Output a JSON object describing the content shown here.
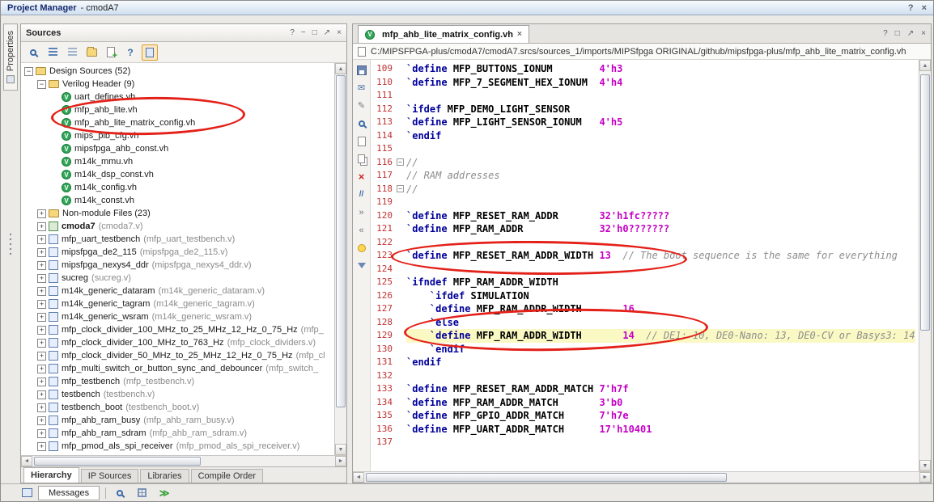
{
  "titlebar": {
    "app": "Project Manager",
    "project": "- cmodA7"
  },
  "glyphs": {
    "help": "?",
    "min": "−",
    "max": "□",
    "float": "↗",
    "close": "×",
    "up": "▲",
    "down": "▼",
    "left": "◄",
    "right": "►",
    "envelope": "✉",
    "pencil": "✎",
    "delete": "×",
    "comment": "//",
    "indent": "»",
    "outdent": "«",
    "run": "≫"
  },
  "side": {
    "properties_tab": "Properties"
  },
  "sources": {
    "title": "Sources",
    "active_tab": "Hierarchy",
    "tabs": [
      "Hierarchy",
      "IP Sources",
      "Libraries",
      "Compile Order"
    ],
    "tree": [
      {
        "label": "Design Sources (52)",
        "indent": 0,
        "exp": "-",
        "icon": "folder"
      },
      {
        "label": "Verilog Header (9)",
        "indent": 1,
        "exp": "-",
        "icon": "folder"
      },
      {
        "label": "uart_defines.vh",
        "indent": 2,
        "icon": "vh"
      },
      {
        "label": "mfp_ahb_lite.vh",
        "indent": 2,
        "icon": "vh"
      },
      {
        "label": "mfp_ahb_lite_matrix_config.vh",
        "indent": 2,
        "icon": "vh"
      },
      {
        "label": "mips_pib_cfg.vh",
        "indent": 2,
        "icon": "vh"
      },
      {
        "label": "mipsfpga_ahb_const.vh",
        "indent": 2,
        "icon": "vh"
      },
      {
        "label": "m14k_mmu.vh",
        "indent": 2,
        "icon": "vh"
      },
      {
        "label": "m14k_dsp_const.vh",
        "indent": 2,
        "icon": "vh"
      },
      {
        "label": "m14k_config.vh",
        "indent": 2,
        "icon": "vh"
      },
      {
        "label": "m14k_const.vh",
        "indent": 2,
        "icon": "vh"
      },
      {
        "label": "Non-module Files (23)",
        "indent": 1,
        "exp": "+",
        "icon": "folder"
      },
      {
        "label": "cmoda7",
        "sub": "(cmoda7.v)",
        "indent": 1,
        "exp": "+",
        "icon": "top",
        "bold": true
      },
      {
        "label": "mfp_uart_testbench",
        "sub": "(mfp_uart_testbench.v)",
        "indent": 1,
        "exp": "+",
        "icon": "mod"
      },
      {
        "label": "mipsfpga_de2_115",
        "sub": "(mipsfpga_de2_115.v)",
        "indent": 1,
        "exp": "+",
        "icon": "mod"
      },
      {
        "label": "mipsfpga_nexys4_ddr",
        "sub": "(mipsfpga_nexys4_ddr.v)",
        "indent": 1,
        "exp": "+",
        "icon": "mod"
      },
      {
        "label": "sucreg",
        "sub": "(sucreg.v)",
        "indent": 1,
        "exp": "+",
        "icon": "mod"
      },
      {
        "label": "m14k_generic_dataram",
        "sub": "(m14k_generic_dataram.v)",
        "indent": 1,
        "exp": "+",
        "icon": "mod"
      },
      {
        "label": "m14k_generic_tagram",
        "sub": "(m14k_generic_tagram.v)",
        "indent": 1,
        "exp": "+",
        "icon": "mod"
      },
      {
        "label": "m14k_generic_wsram",
        "sub": "(m14k_generic_wsram.v)",
        "indent": 1,
        "exp": "+",
        "icon": "mod"
      },
      {
        "label": "mfp_clock_divider_100_MHz_to_25_MHz_12_Hz_0_75_Hz",
        "sub": "(mfp_",
        "indent": 1,
        "exp": "+",
        "icon": "mod"
      },
      {
        "label": "mfp_clock_divider_100_MHz_to_763_Hz",
        "sub": "(mfp_clock_dividers.v)",
        "indent": 1,
        "exp": "+",
        "icon": "mod"
      },
      {
        "label": "mfp_clock_divider_50_MHz_to_25_MHz_12_Hz_0_75_Hz",
        "sub": "(mfp_cl",
        "indent": 1,
        "exp": "+",
        "icon": "mod"
      },
      {
        "label": "mfp_multi_switch_or_button_sync_and_debouncer",
        "sub": "(mfp_switch_",
        "indent": 1,
        "exp": "+",
        "icon": "mod"
      },
      {
        "label": "mfp_testbench",
        "sub": "(mfp_testbench.v)",
        "indent": 1,
        "exp": "+",
        "icon": "mod"
      },
      {
        "label": "testbench",
        "sub": "(testbench.v)",
        "indent": 1,
        "exp": "+",
        "icon": "mod"
      },
      {
        "label": "testbench_boot",
        "sub": "(testbench_boot.v)",
        "indent": 1,
        "exp": "+",
        "icon": "mod"
      },
      {
        "label": "mfp_ahb_ram_busy",
        "sub": "(mfp_ahb_ram_busy.v)",
        "indent": 1,
        "exp": "+",
        "icon": "mod"
      },
      {
        "label": "mfp_ahb_ram_sdram",
        "sub": "(mfp_ahb_ram_sdram.v)",
        "indent": 1,
        "exp": "+",
        "icon": "mod"
      },
      {
        "label": "mfp_pmod_als_spi_receiver",
        "sub": "(mfp_pmod_als_spi_receiver.v)",
        "indent": 1,
        "exp": "+",
        "icon": "mod"
      }
    ]
  },
  "editor": {
    "tab_label": "mfp_ahb_lite_matrix_config.vh",
    "path": "C:/MIPSFPGA-plus/cmodA7/cmodA7.srcs/sources_1/imports/MIPSfpga ORIGINAL/github/mipsfpga-plus/mfp_ahb_lite_matrix_config.vh",
    "lines": [
      {
        "n": 109,
        "seg": [
          [
            "k",
            "`define"
          ],
          [
            "p",
            " "
          ],
          [
            "i",
            "MFP_BUTTONS_IONUM"
          ],
          [
            "p",
            "        "
          ],
          [
            "v",
            "4'h3"
          ]
        ]
      },
      {
        "n": 110,
        "seg": [
          [
            "k",
            "`define"
          ],
          [
            "p",
            " "
          ],
          [
            "i",
            "MFP_7_SEGMENT_HEX_IONUM"
          ],
          [
            "p",
            "  "
          ],
          [
            "v",
            "4'h4"
          ]
        ]
      },
      {
        "n": 111,
        "seg": []
      },
      {
        "n": 112,
        "seg": [
          [
            "k",
            "`ifdef"
          ],
          [
            "p",
            " "
          ],
          [
            "i",
            "MFP_DEMO_LIGHT_SENSOR"
          ]
        ]
      },
      {
        "n": 113,
        "seg": [
          [
            "k",
            "`define"
          ],
          [
            "p",
            " "
          ],
          [
            "i",
            "MFP_LIGHT_SENSOR_IONUM"
          ],
          [
            "p",
            "   "
          ],
          [
            "v",
            "4'h5"
          ]
        ]
      },
      {
        "n": 114,
        "seg": [
          [
            "k",
            "`endif"
          ]
        ]
      },
      {
        "n": 115,
        "seg": []
      },
      {
        "n": 116,
        "fold": true,
        "seg": [
          [
            "c",
            "//"
          ]
        ]
      },
      {
        "n": 117,
        "seg": [
          [
            "c",
            "// RAM addresses"
          ]
        ]
      },
      {
        "n": 118,
        "fold": true,
        "seg": [
          [
            "c",
            "//"
          ]
        ]
      },
      {
        "n": 119,
        "seg": []
      },
      {
        "n": 120,
        "seg": [
          [
            "k",
            "`define"
          ],
          [
            "p",
            " "
          ],
          [
            "i",
            "MFP_RESET_RAM_ADDR"
          ],
          [
            "p",
            "       "
          ],
          [
            "v",
            "32'h1fc?????"
          ]
        ]
      },
      {
        "n": 121,
        "seg": [
          [
            "k",
            "`define"
          ],
          [
            "p",
            " "
          ],
          [
            "i",
            "MFP_RAM_ADDR"
          ],
          [
            "p",
            "             "
          ],
          [
            "v",
            "32'h0???????"
          ]
        ]
      },
      {
        "n": 122,
        "seg": []
      },
      {
        "n": 123,
        "seg": [
          [
            "k",
            "`define"
          ],
          [
            "p",
            " "
          ],
          [
            "i",
            "MFP_RESET_RAM_ADDR_WIDTH"
          ],
          [
            "p",
            " "
          ],
          [
            "v",
            "13"
          ],
          [
            "p",
            "  "
          ],
          [
            "c",
            "// The boot sequence is the same for everything"
          ]
        ]
      },
      {
        "n": 124,
        "seg": []
      },
      {
        "n": 125,
        "seg": [
          [
            "k",
            "`ifndef"
          ],
          [
            "p",
            " "
          ],
          [
            "i",
            "MFP_RAM_ADDR_WIDTH"
          ]
        ]
      },
      {
        "n": 126,
        "seg": [
          [
            "p",
            "    "
          ],
          [
            "k",
            "`ifdef"
          ],
          [
            "p",
            " "
          ],
          [
            "i",
            "SIMULATION"
          ]
        ]
      },
      {
        "n": 127,
        "seg": [
          [
            "p",
            "    "
          ],
          [
            "k",
            "`define"
          ],
          [
            "p",
            " "
          ],
          [
            "i",
            "MFP_RAM_ADDR_WIDTH"
          ],
          [
            "p",
            "       "
          ],
          [
            "v",
            "16"
          ]
        ]
      },
      {
        "n": 128,
        "seg": [
          [
            "p",
            "    "
          ],
          [
            "k",
            "`else"
          ]
        ]
      },
      {
        "n": 129,
        "hl": true,
        "seg": [
          [
            "p",
            "    "
          ],
          [
            "k",
            "`define"
          ],
          [
            "p",
            " "
          ],
          [
            "i",
            "MFP_RAM_ADDR_WIDTH"
          ],
          [
            "p",
            "       "
          ],
          [
            "v",
            "14"
          ],
          [
            "p",
            "  "
          ],
          [
            "c",
            "// DE1: 10, DE0-Nano: 13, DE0-CV or Basys3: 14"
          ]
        ]
      },
      {
        "n": 130,
        "seg": [
          [
            "p",
            "    "
          ],
          [
            "k",
            "`endif"
          ]
        ]
      },
      {
        "n": 131,
        "seg": [
          [
            "k",
            "`endif"
          ]
        ]
      },
      {
        "n": 132,
        "seg": []
      },
      {
        "n": 133,
        "seg": [
          [
            "k",
            "`define"
          ],
          [
            "p",
            " "
          ],
          [
            "i",
            "MFP_RESET_RAM_ADDR_MATCH"
          ],
          [
            "p",
            " "
          ],
          [
            "v",
            "7'h7f"
          ]
        ]
      },
      {
        "n": 134,
        "seg": [
          [
            "k",
            "`define"
          ],
          [
            "p",
            " "
          ],
          [
            "i",
            "MFP_RAM_ADDR_MATCH"
          ],
          [
            "p",
            "       "
          ],
          [
            "v",
            "3'b0"
          ]
        ]
      },
      {
        "n": 135,
        "seg": [
          [
            "k",
            "`define"
          ],
          [
            "p",
            " "
          ],
          [
            "i",
            "MFP_GPIO_ADDR_MATCH"
          ],
          [
            "p",
            "      "
          ],
          [
            "v",
            "7'h7e"
          ]
        ]
      },
      {
        "n": 136,
        "seg": [
          [
            "k",
            "`define"
          ],
          [
            "p",
            " "
          ],
          [
            "i",
            "MFP_UART_ADDR_MATCH"
          ],
          [
            "p",
            "      "
          ],
          [
            "v",
            "17'h10401"
          ]
        ]
      },
      {
        "n": 137,
        "seg": []
      }
    ]
  },
  "messages": {
    "label": "Messages"
  },
  "colors": {
    "annotation": "#e32119",
    "line_highlight": "#fbf9c3",
    "keyword": "#00009b",
    "value": "#c400c4",
    "comment": "#8c8c8c",
    "line_number": "#c03232"
  }
}
